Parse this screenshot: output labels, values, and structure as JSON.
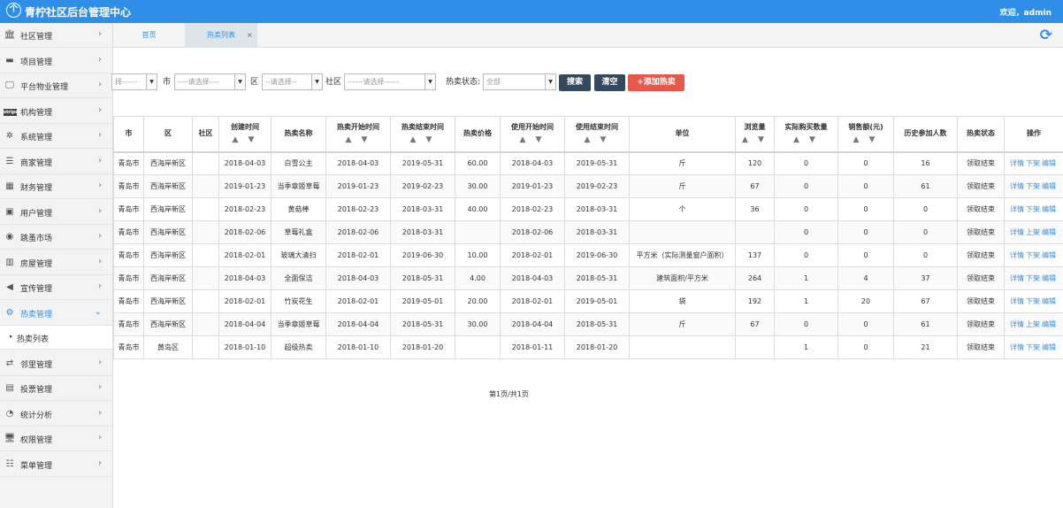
{
  "header": {
    "title": "青柠社区后台管理中心",
    "logo_icon": "leaf-logo-icon",
    "welcome": "欢迎，admin"
  },
  "sidebar": {
    "items": [
      {
        "label": "社区管理",
        "icon": "bank-icon",
        "glyph": "🏛"
      },
      {
        "label": "项目管理",
        "icon": "project-icon",
        "glyph": "▬"
      },
      {
        "label": "平台物业管理",
        "icon": "monitor-icon",
        "glyph": "🖵"
      },
      {
        "label": "机构管理",
        "icon": "stripe-icon",
        "glyph": "stripe"
      },
      {
        "label": "系统管理",
        "icon": "settings-icon",
        "glyph": "✲"
      },
      {
        "label": "商家管理",
        "icon": "list-icon",
        "glyph": "☰"
      },
      {
        "label": "财务管理",
        "icon": "calculator-icon",
        "glyph": "▦"
      },
      {
        "label": "用户管理",
        "icon": "user-icon",
        "glyph": "▣"
      },
      {
        "label": "跳蚤市场",
        "icon": "market-icon",
        "glyph": "◉"
      },
      {
        "label": "房屋管理",
        "icon": "house-icon",
        "glyph": "▥"
      },
      {
        "label": "宣传管理",
        "icon": "megaphone-icon",
        "glyph": "◀"
      },
      {
        "label": "热卖管理",
        "icon": "gear-icon",
        "glyph": "⚙"
      },
      {
        "label": "邻里管理",
        "icon": "retweet-icon",
        "glyph": "⇄"
      },
      {
        "label": "投票管理",
        "icon": "vote-icon",
        "glyph": "▤"
      },
      {
        "label": "统计分析",
        "icon": "pie-chart-icon",
        "glyph": "◔"
      },
      {
        "label": "权限管理",
        "icon": "desktop-icon",
        "glyph": "🖥"
      },
      {
        "label": "菜单管理",
        "icon": "menu-icon",
        "glyph": "☷"
      }
    ],
    "active_index": 11,
    "submenu": {
      "bullet": "▸",
      "label": "热卖列表"
    }
  },
  "tabs": {
    "home": "首页",
    "current": "热卖列表",
    "close": "×",
    "refresh_icon": "refresh-icon"
  },
  "filters": {
    "province_select": "择------",
    "city_label": "市",
    "city_select": "----请选择----",
    "district_label": "区",
    "district_select": "--请选择--",
    "community_label": "社区",
    "community_select": "------请选择------",
    "status_label": "热卖状态:",
    "status_select": "全部",
    "search_button": "搜索",
    "clear_button": "清空",
    "add_button": "+添加热卖"
  },
  "table": {
    "sort_glyph": "▲ ▼",
    "columns": [
      {
        "label": "市",
        "sort": false
      },
      {
        "label": "区",
        "sort": false
      },
      {
        "label": "社区",
        "sort": false
      },
      {
        "label": "创建时间",
        "sort": true
      },
      {
        "label": "热卖名称",
        "sort": false
      },
      {
        "label": "热卖开始时间",
        "sort": true
      },
      {
        "label": "热卖结束时间",
        "sort": true
      },
      {
        "label": "热卖价格",
        "sort": false
      },
      {
        "label": "使用开始时间",
        "sort": true
      },
      {
        "label": "使用结束时间",
        "sort": true
      },
      {
        "label": "单位",
        "sort": false
      },
      {
        "label": "浏览量",
        "sort": true
      },
      {
        "label": "实际购买数量",
        "sort": true
      },
      {
        "label": "销售额(元)",
        "sort": true
      },
      {
        "label": "历史参加人数",
        "sort": false
      },
      {
        "label": "热卖状态",
        "sort": false
      },
      {
        "label": "操作",
        "sort": false
      }
    ],
    "rows": [
      {
        "cells": [
          "青岛市",
          "西海岸新区",
          "",
          "2018-04-03",
          "白雪公主",
          "2018-04-03",
          "2019-05-31",
          "60.00",
          "2018-04-03",
          "2019-05-31",
          "斤",
          "120",
          "0",
          "0",
          "16",
          "领取结束"
        ],
        "actions": [
          "详情",
          "下架",
          "编辑"
        ]
      },
      {
        "cells": [
          "青岛市",
          "西海岸新区",
          "",
          "2019-01-23",
          "当季章姬草莓",
          "2019-01-23",
          "2019-02-23",
          "30.00",
          "2019-01-23",
          "2019-02-23",
          "斤",
          "67",
          "0",
          "0",
          "61",
          "领取结束"
        ],
        "actions": [
          "详情",
          "下架",
          "编辑"
        ]
      },
      {
        "cells": [
          "青岛市",
          "西海岸新区",
          "",
          "2018-02-23",
          "黄菇棒",
          "2018-02-23",
          "2018-03-31",
          "40.00",
          "2018-02-23",
          "2018-03-31",
          "个",
          "36",
          "0",
          "0",
          "0",
          "领取结束"
        ],
        "actions": [
          "详情",
          "下架",
          "编辑"
        ]
      },
      {
        "cells": [
          "青岛市",
          "西海岸新区",
          "",
          "2018-02-06",
          "草莓礼盒",
          "2018-02-06",
          "2018-03-31",
          "",
          "2018-02-06",
          "2018-03-31",
          "",
          "",
          "0",
          "0",
          "0",
          "领取结束"
        ],
        "actions": [
          "详情",
          "上架",
          "编辑"
        ]
      },
      {
        "cells": [
          "青岛市",
          "西海岸新区",
          "",
          "2018-02-01",
          "玻璃大清扫",
          "2018-02-01",
          "2019-06-30",
          "10.00",
          "2018-02-01",
          "2019-06-30",
          "平方米（实际测量窗户面积）",
          "137",
          "0",
          "0",
          "0",
          "领取结束"
        ],
        "actions": [
          "详情",
          "下架",
          "编辑"
        ]
      },
      {
        "cells": [
          "青岛市",
          "西海岸新区",
          "",
          "2018-04-03",
          "全面保洁",
          "2018-04-03",
          "2018-05-31",
          "4.00",
          "2018-04-03",
          "2018-05-31",
          "建筑面积/平方米",
          "264",
          "1",
          "4",
          "37",
          "领取结束"
        ],
        "actions": [
          "详情",
          "下架",
          "编辑"
        ]
      },
      {
        "cells": [
          "青岛市",
          "西海岸新区",
          "",
          "2018-02-01",
          "竹炭花生",
          "2018-02-01",
          "2019-05-01",
          "20.00",
          "2018-02-01",
          "2019-05-01",
          "袋",
          "192",
          "1",
          "20",
          "67",
          "领取结束"
        ],
        "actions": [
          "详情",
          "下架",
          "编辑"
        ]
      },
      {
        "cells": [
          "青岛市",
          "西海岸新区",
          "",
          "2018-04-04",
          "当季章姬草莓",
          "2018-04-04",
          "2018-05-31",
          "30.00",
          "2018-04-04",
          "2018-05-31",
          "斤",
          "67",
          "0",
          "0",
          "61",
          "领取结束"
        ],
        "actions": [
          "详情",
          "上架",
          "编辑"
        ]
      },
      {
        "cells": [
          "青岛市",
          "黄岛区",
          "",
          "2018-01-10",
          "超级热卖",
          "2018-01-10",
          "2018-01-20",
          "",
          "2018-01-11",
          "2018-01-20",
          "",
          "",
          "1",
          "0",
          "21",
          "领取结束"
        ],
        "actions": [
          "详情",
          "下架",
          "编辑"
        ]
      }
    ]
  },
  "pagination": {
    "text": "第1页/共1页"
  },
  "colors": {
    "primary": "#2f8fe8",
    "dark_button": "#34495e",
    "add_button": "#e8584a"
  }
}
